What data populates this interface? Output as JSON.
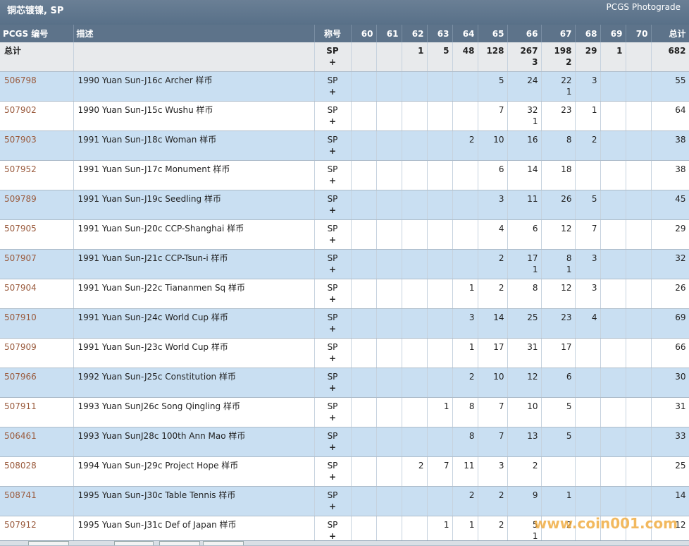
{
  "header": {
    "title": "铜芯镀镍, SP",
    "brand": "PCGS Photograde"
  },
  "columns": [
    "PCGS 编号",
    "描述",
    "称号",
    "60",
    "61",
    "62",
    "63",
    "64",
    "65",
    "66",
    "67",
    "68",
    "69",
    "70",
    "总计"
  ],
  "total_row": {
    "label": "总计",
    "desig": "SP",
    "plus": "+",
    "g60": "",
    "g61": "",
    "g62": "1",
    "g63": "5",
    "g64": "48",
    "g65": "128",
    "g66": "267",
    "g66b": "3",
    "g67": "198",
    "g67b": "2",
    "g68": "29",
    "g69": "1",
    "g70": "",
    "total": "682"
  },
  "rows": [
    {
      "id": "506798",
      "desc": "1990 Yuan Sun-J16c Archer 样币",
      "desig": "SP",
      "plus": "+",
      "g63": "",
      "g64": "",
      "g65": "5",
      "g66": "24",
      "g66b": "",
      "g67": "22",
      "g67b": "1",
      "g68": "3",
      "total": "55"
    },
    {
      "id": "507902",
      "desc": "1990 Yuan Sun-J15c Wushu 样币",
      "desig": "SP",
      "plus": "+",
      "g63": "",
      "g64": "",
      "g65": "7",
      "g66": "32",
      "g66b": "1",
      "g67": "23",
      "g67b": "",
      "g68": "1",
      "total": "64"
    },
    {
      "id": "507903",
      "desc": "1991 Yuan Sun-J18c Woman 样币",
      "desig": "SP",
      "plus": "+",
      "g63": "",
      "g64": "2",
      "g65": "10",
      "g66": "16",
      "g66b": "",
      "g67": "8",
      "g67b": "",
      "g68": "2",
      "total": "38"
    },
    {
      "id": "507952",
      "desc": "1991 Yuan Sun-J17c Monument 样币",
      "desig": "SP",
      "plus": "+",
      "g63": "",
      "g64": "",
      "g65": "6",
      "g66": "14",
      "g66b": "",
      "g67": "18",
      "g67b": "",
      "g68": "",
      "total": "38"
    },
    {
      "id": "509789",
      "desc": "1991 Yuan Sun-J19c Seedling 样币",
      "desig": "SP",
      "plus": "+",
      "g63": "",
      "g64": "",
      "g65": "3",
      "g66": "11",
      "g66b": "",
      "g67": "26",
      "g67b": "",
      "g68": "5",
      "total": "45"
    },
    {
      "id": "507905",
      "desc": "1991 Yuan Sun-J20c CCP-Shanghai 样币",
      "desig": "SP",
      "plus": "+",
      "g63": "",
      "g64": "",
      "g65": "4",
      "g66": "6",
      "g66b": "",
      "g67": "12",
      "g67b": "",
      "g68": "7",
      "total": "29"
    },
    {
      "id": "507907",
      "desc": "1991 Yuan Sun-J21c CCP-Tsun-i 样币",
      "desig": "SP",
      "plus": "+",
      "g63": "",
      "g64": "",
      "g65": "2",
      "g66": "17",
      "g66b": "1",
      "g67": "8",
      "g67b": "1",
      "g68": "3",
      "total": "32"
    },
    {
      "id": "507904",
      "desc": "1991 Yuan Sun-J22c Tiananmen Sq 样币",
      "desig": "SP",
      "plus": "+",
      "g63": "",
      "g64": "1",
      "g65": "2",
      "g66": "8",
      "g66b": "",
      "g67": "12",
      "g67b": "",
      "g68": "3",
      "total": "26"
    },
    {
      "id": "507910",
      "desc": "1991 Yuan Sun-J24c World Cup 样币",
      "desig": "SP",
      "plus": "+",
      "g63": "",
      "g64": "3",
      "g65": "14",
      "g66": "25",
      "g66b": "",
      "g67": "23",
      "g67b": "",
      "g68": "4",
      "total": "69"
    },
    {
      "id": "507909",
      "desc": "1991 Yuan Sun-J23c World Cup 样币",
      "desig": "SP",
      "plus": "+",
      "g63": "",
      "g64": "1",
      "g65": "17",
      "g66": "31",
      "g66b": "",
      "g67": "17",
      "g67b": "",
      "g68": "",
      "total": "66"
    },
    {
      "id": "507966",
      "desc": "1992 Yuan Sun-J25c Constitution 样币",
      "desig": "SP",
      "plus": "+",
      "g63": "",
      "g64": "2",
      "g65": "10",
      "g66": "12",
      "g66b": "",
      "g67": "6",
      "g67b": "",
      "g68": "",
      "total": "30"
    },
    {
      "id": "507911",
      "desc": "1993 Yuan SunJ26c Song Qingling 样币",
      "desig": "SP",
      "plus": "+",
      "g63": "1",
      "g64": "8",
      "g65": "7",
      "g66": "10",
      "g66b": "",
      "g67": "5",
      "g67b": "",
      "g68": "",
      "total": "31"
    },
    {
      "id": "506461",
      "desc": "1993 Yuan SunJ28c 100th Ann Mao 样币",
      "desig": "SP",
      "plus": "+",
      "g63": "",
      "g64": "8",
      "g65": "7",
      "g66": "13",
      "g66b": "",
      "g67": "5",
      "g67b": "",
      "g68": "",
      "total": "33"
    },
    {
      "id": "508028",
      "desc": "1994 Yuan Sun-J29c Project Hope 样币",
      "desig": "SP",
      "plus": "+",
      "g62": "2",
      "g63": "7",
      "g64": "11",
      "g65": "3",
      "g66": "2",
      "g66b": "",
      "g67": "",
      "g67b": "",
      "g68": "",
      "total": "25",
      "shift": true
    },
    {
      "id": "508741",
      "desc": "1995 Yuan Sun-J30c Table Tennis 样币",
      "desig": "SP",
      "plus": "+",
      "g63": "",
      "g64": "2",
      "g65": "2",
      "g66": "9",
      "g66b": "",
      "g67": "1",
      "g67b": "",
      "g68": "",
      "total": "14"
    },
    {
      "id": "507912",
      "desc": "1995 Yuan Sun-J31c Def of Japan 样币",
      "desig": "SP",
      "plus": "+",
      "g63": "1",
      "g64": "1",
      "g65": "2",
      "g66": "5",
      "g66b": "1",
      "g67": "2",
      "g67b": "",
      "g68": "",
      "total": "12"
    }
  ],
  "watermark": "www.coin001.com"
}
